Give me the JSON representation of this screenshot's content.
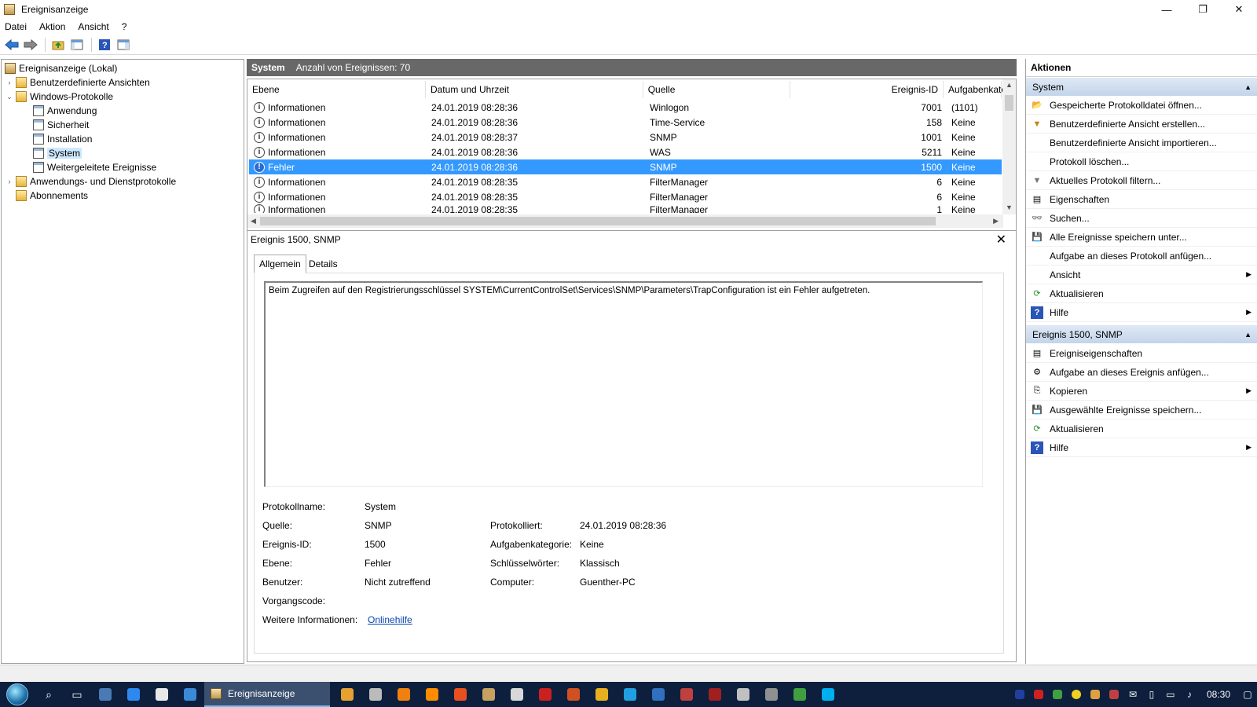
{
  "window": {
    "title": "Ereignisanzeige",
    "min_glyph": "—",
    "max_glyph": "❐",
    "close_glyph": "✕"
  },
  "menu": [
    "Datei",
    "Aktion",
    "Ansicht",
    "?"
  ],
  "tree": [
    {
      "label": "Ereignisanzeige (Lokal)",
      "icon": "root"
    },
    {
      "label": "Benutzerdefinierte Ansichten",
      "icon": "folder",
      "exp": "›"
    },
    {
      "label": "Windows-Protokolle",
      "icon": "folder",
      "exp": "⌄"
    },
    {
      "label": "Anwendung",
      "icon": "log"
    },
    {
      "label": "Sicherheit",
      "icon": "log"
    },
    {
      "label": "Installation",
      "icon": "log"
    },
    {
      "label": "System",
      "icon": "log",
      "selected": true
    },
    {
      "label": "Weitergeleitete Ereignisse",
      "icon": "log"
    },
    {
      "label": "Anwendungs- und Dienstprotokolle",
      "icon": "folder",
      "exp": "›"
    },
    {
      "label": "Abonnements",
      "icon": "folder"
    }
  ],
  "log_header": {
    "name": "System",
    "count": "Anzahl von Ereignissen: 70"
  },
  "columns": [
    "Ebene",
    "Datum und Uhrzeit",
    "Quelle",
    "Ereignis-ID",
    "Aufgabenkate"
  ],
  "events": [
    {
      "level": "Informationen",
      "date": "24.01.2019 08:28:36",
      "source": "Winlogon",
      "id": "7001",
      "task": "(1101)"
    },
    {
      "level": "Informationen",
      "date": "24.01.2019 08:28:36",
      "source": "Time-Service",
      "id": "158",
      "task": "Keine"
    },
    {
      "level": "Informationen",
      "date": "24.01.2019 08:28:37",
      "source": "SNMP",
      "id": "1001",
      "task": "Keine"
    },
    {
      "level": "Informationen",
      "date": "24.01.2019 08:28:36",
      "source": "WAS",
      "id": "5211",
      "task": "Keine"
    },
    {
      "level": "Fehler",
      "date": "24.01.2019 08:28:36",
      "source": "SNMP",
      "id": "1500",
      "task": "Keine",
      "selected": true
    },
    {
      "level": "Informationen",
      "date": "24.01.2019 08:28:35",
      "source": "FilterManager",
      "id": "6",
      "task": "Keine"
    },
    {
      "level": "Informationen",
      "date": "24.01.2019 08:28:35",
      "source": "FilterManager",
      "id": "6",
      "task": "Keine"
    },
    {
      "level": "Informationen",
      "date": "24.01.2019 08:28:35",
      "source": "FilterManager",
      "id": "1",
      "task": "Keine"
    }
  ],
  "detail": {
    "title": "Ereignis 1500, SNMP",
    "tabs": [
      "Allgemein",
      "Details"
    ],
    "message": "Beim Zugreifen auf den Registrierungsschlüssel SYSTEM\\CurrentControlSet\\Services\\SNMP\\Parameters\\TrapConfiguration ist ein Fehler aufgetreten.",
    "labels": {
      "logname": "Protokollname:",
      "source": "Quelle:",
      "eventid": "Ereignis-ID:",
      "level": "Ebene:",
      "user": "Benutzer:",
      "opcode": "Vorgangscode:",
      "moreinfo": "Weitere Informationen:",
      "logged": "Protokolliert:",
      "taskcat": "Aufgabenkategorie:",
      "keywords": "Schlüsselwörter:",
      "computer": "Computer:"
    },
    "values": {
      "logname": "System",
      "source": "SNMP",
      "eventid": "1500",
      "level": "Fehler",
      "user": "Nicht zutreffend",
      "opcode": "",
      "moreinfo": "Onlinehilfe",
      "logged": "24.01.2019 08:28:36",
      "taskcat": "Keine",
      "keywords": "Klassisch",
      "computer": "Guenther-PC"
    }
  },
  "actions": {
    "title": "Aktionen",
    "section1": {
      "label": "System",
      "items": [
        {
          "label": "Gespeicherte Protokolldatei öffnen...",
          "icon": "open-folder-icon",
          "glyph": "📂"
        },
        {
          "label": "Benutzerdefinierte Ansicht erstellen...",
          "icon": "filter-icon",
          "glyph": "▼"
        },
        {
          "label": "Benutzerdefinierte Ansicht importieren...",
          "icon": "",
          "glyph": ""
        },
        {
          "label": "Protokoll löschen...",
          "icon": "",
          "glyph": ""
        },
        {
          "label": "Aktuelles Protokoll filtern...",
          "icon": "filter-icon",
          "glyph": "▼"
        },
        {
          "label": "Eigenschaften",
          "icon": "properties-icon",
          "glyph": "▤"
        },
        {
          "label": "Suchen...",
          "icon": "binoculars-icon",
          "glyph": "👓"
        },
        {
          "label": "Alle Ereignisse speichern unter...",
          "icon": "save-icon",
          "glyph": "💾"
        },
        {
          "label": "Aufgabe an dieses Protokoll anfügen...",
          "icon": "",
          "glyph": ""
        },
        {
          "label": "Ansicht",
          "icon": "",
          "glyph": "",
          "sub": true
        },
        {
          "label": "Aktualisieren",
          "icon": "refresh-icon",
          "glyph": "⟳"
        },
        {
          "label": "Hilfe",
          "icon": "help-icon",
          "glyph": "?",
          "sub": true
        }
      ]
    },
    "section2": {
      "label": "Ereignis 1500, SNMP",
      "items": [
        {
          "label": "Ereigniseigenschaften",
          "icon": "properties-icon",
          "glyph": "▤"
        },
        {
          "label": "Aufgabe an dieses Ereignis anfügen...",
          "icon": "task-icon",
          "glyph": "⚙"
        },
        {
          "label": "Kopieren",
          "icon": "copy-icon",
          "glyph": "⎘",
          "sub": true
        },
        {
          "label": "Ausgewählte Ereignisse speichern...",
          "icon": "save-icon",
          "glyph": "💾"
        },
        {
          "label": "Aktualisieren",
          "icon": "refresh-icon",
          "glyph": "⟳"
        },
        {
          "label": "Hilfe",
          "icon": "help-icon",
          "glyph": "?",
          "sub": true
        }
      ]
    }
  },
  "taskbar": {
    "active_task": "Ereignisanzeige",
    "clock": "08:30"
  },
  "colors": {
    "selection": "#3399ff",
    "header_bar": "#686868",
    "section_bg": "#c3d4ea",
    "taskbar": "#0d1f3d"
  }
}
